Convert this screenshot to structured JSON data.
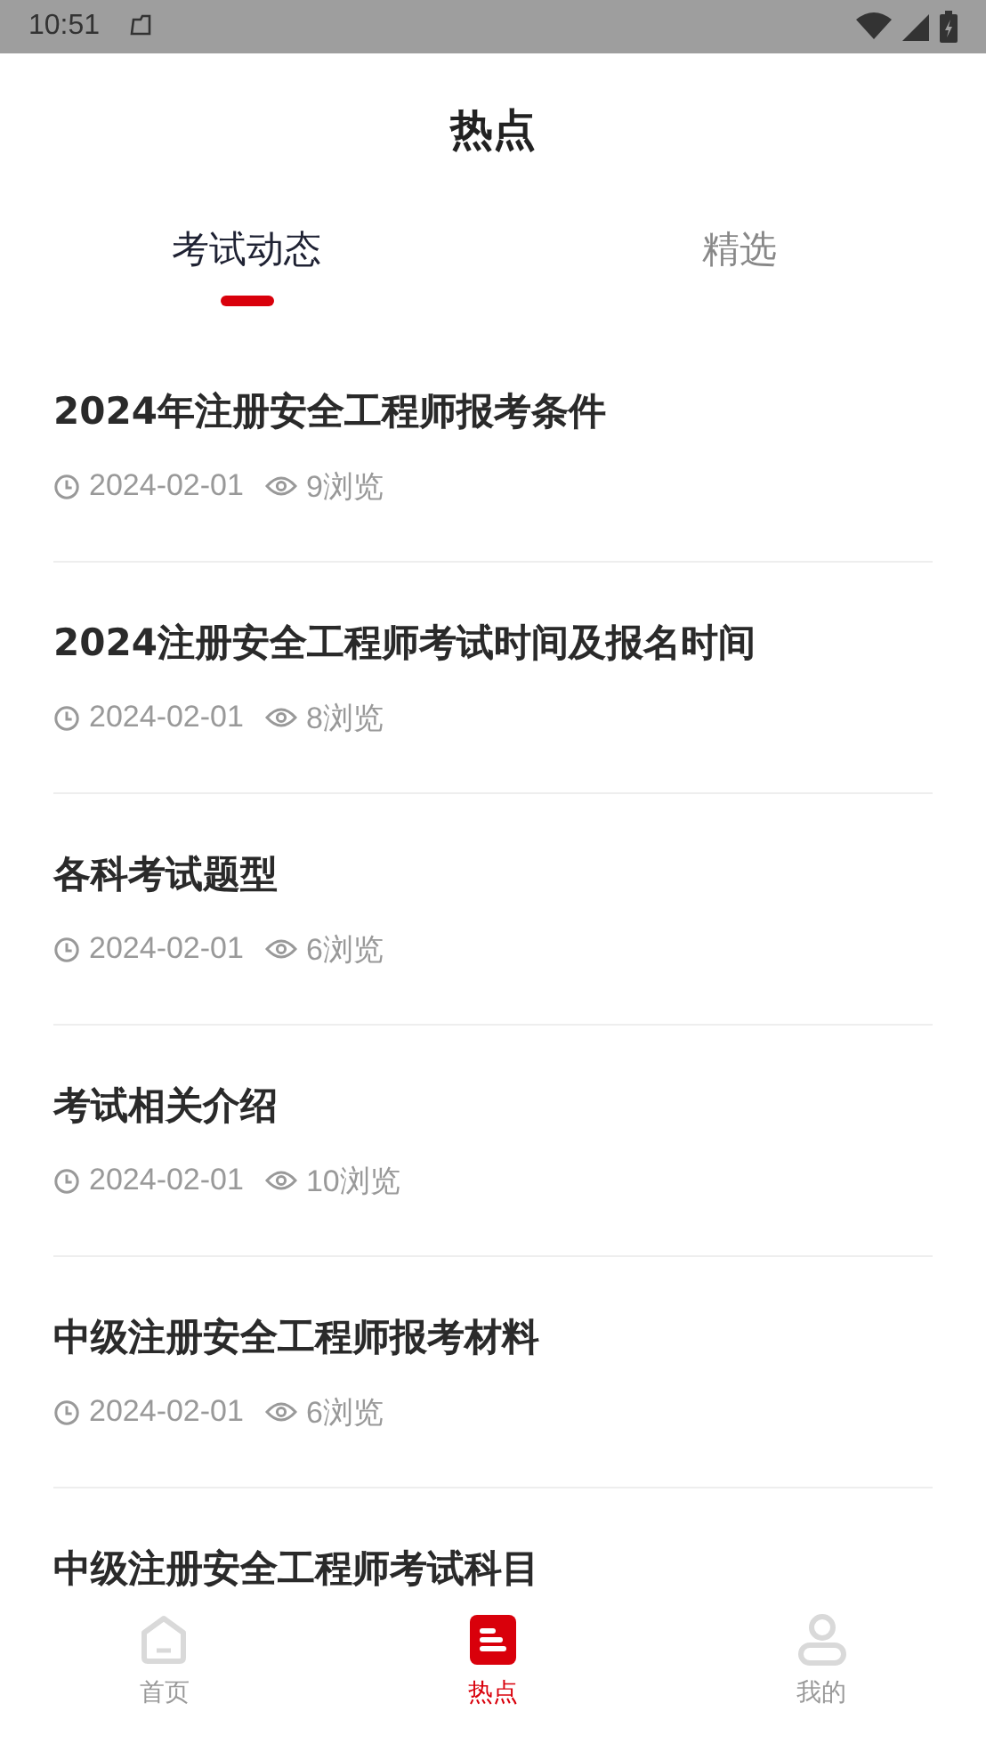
{
  "status_bar": {
    "time": "10:51"
  },
  "header": {
    "title": "热点"
  },
  "tabs": [
    {
      "label": "考试动态",
      "selected": true
    },
    {
      "label": "精选",
      "selected": false
    }
  ],
  "articles": [
    {
      "title": "2024年注册安全工程师报考条件",
      "date": "2024-02-01",
      "views": "9浏览"
    },
    {
      "title": "2024注册安全工程师考试时间及报名时间",
      "date": "2024-02-01",
      "views": "8浏览"
    },
    {
      "title": "各科考试题型",
      "date": "2024-02-01",
      "views": "6浏览"
    },
    {
      "title": "考试相关介绍",
      "date": "2024-02-01",
      "views": "10浏览"
    },
    {
      "title": "中级注册安全工程师报考材料",
      "date": "2024-02-01",
      "views": "6浏览"
    },
    {
      "title": "中级注册安全工程师考试科目"
    }
  ],
  "bottom_nav": [
    {
      "kind": "home",
      "label": "首页",
      "selected": false
    },
    {
      "kind": "hot",
      "label": "热点",
      "selected": true
    },
    {
      "kind": "me",
      "label": "我的",
      "selected": false
    }
  ]
}
